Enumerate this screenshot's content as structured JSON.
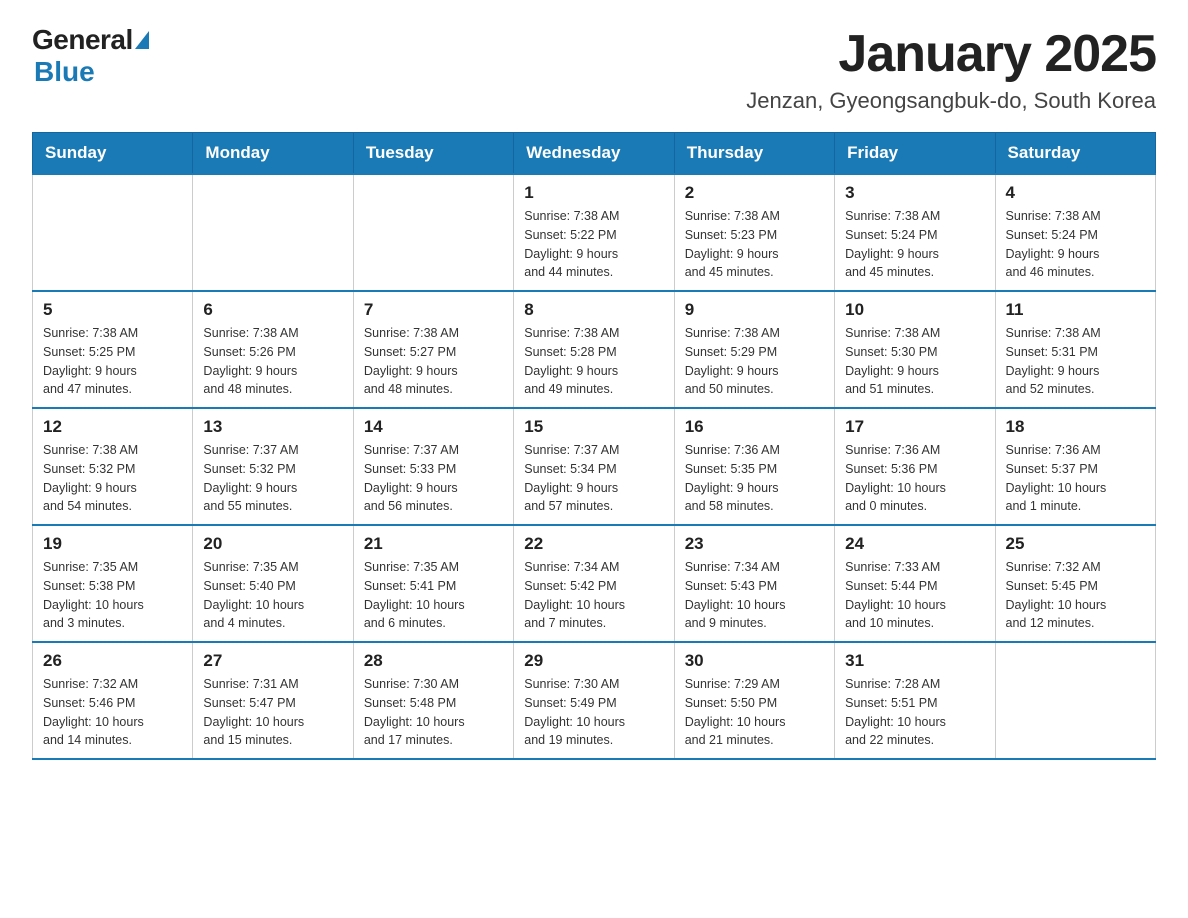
{
  "header": {
    "logo_general": "General",
    "logo_blue": "Blue",
    "title": "January 2025",
    "subtitle": "Jenzan, Gyeongsangbuk-do, South Korea"
  },
  "weekdays": [
    "Sunday",
    "Monday",
    "Tuesday",
    "Wednesday",
    "Thursday",
    "Friday",
    "Saturday"
  ],
  "weeks": [
    [
      {
        "day": "",
        "info": ""
      },
      {
        "day": "",
        "info": ""
      },
      {
        "day": "",
        "info": ""
      },
      {
        "day": "1",
        "info": "Sunrise: 7:38 AM\nSunset: 5:22 PM\nDaylight: 9 hours\nand 44 minutes."
      },
      {
        "day": "2",
        "info": "Sunrise: 7:38 AM\nSunset: 5:23 PM\nDaylight: 9 hours\nand 45 minutes."
      },
      {
        "day": "3",
        "info": "Sunrise: 7:38 AM\nSunset: 5:24 PM\nDaylight: 9 hours\nand 45 minutes."
      },
      {
        "day": "4",
        "info": "Sunrise: 7:38 AM\nSunset: 5:24 PM\nDaylight: 9 hours\nand 46 minutes."
      }
    ],
    [
      {
        "day": "5",
        "info": "Sunrise: 7:38 AM\nSunset: 5:25 PM\nDaylight: 9 hours\nand 47 minutes."
      },
      {
        "day": "6",
        "info": "Sunrise: 7:38 AM\nSunset: 5:26 PM\nDaylight: 9 hours\nand 48 minutes."
      },
      {
        "day": "7",
        "info": "Sunrise: 7:38 AM\nSunset: 5:27 PM\nDaylight: 9 hours\nand 48 minutes."
      },
      {
        "day": "8",
        "info": "Sunrise: 7:38 AM\nSunset: 5:28 PM\nDaylight: 9 hours\nand 49 minutes."
      },
      {
        "day": "9",
        "info": "Sunrise: 7:38 AM\nSunset: 5:29 PM\nDaylight: 9 hours\nand 50 minutes."
      },
      {
        "day": "10",
        "info": "Sunrise: 7:38 AM\nSunset: 5:30 PM\nDaylight: 9 hours\nand 51 minutes."
      },
      {
        "day": "11",
        "info": "Sunrise: 7:38 AM\nSunset: 5:31 PM\nDaylight: 9 hours\nand 52 minutes."
      }
    ],
    [
      {
        "day": "12",
        "info": "Sunrise: 7:38 AM\nSunset: 5:32 PM\nDaylight: 9 hours\nand 54 minutes."
      },
      {
        "day": "13",
        "info": "Sunrise: 7:37 AM\nSunset: 5:32 PM\nDaylight: 9 hours\nand 55 minutes."
      },
      {
        "day": "14",
        "info": "Sunrise: 7:37 AM\nSunset: 5:33 PM\nDaylight: 9 hours\nand 56 minutes."
      },
      {
        "day": "15",
        "info": "Sunrise: 7:37 AM\nSunset: 5:34 PM\nDaylight: 9 hours\nand 57 minutes."
      },
      {
        "day": "16",
        "info": "Sunrise: 7:36 AM\nSunset: 5:35 PM\nDaylight: 9 hours\nand 58 minutes."
      },
      {
        "day": "17",
        "info": "Sunrise: 7:36 AM\nSunset: 5:36 PM\nDaylight: 10 hours\nand 0 minutes."
      },
      {
        "day": "18",
        "info": "Sunrise: 7:36 AM\nSunset: 5:37 PM\nDaylight: 10 hours\nand 1 minute."
      }
    ],
    [
      {
        "day": "19",
        "info": "Sunrise: 7:35 AM\nSunset: 5:38 PM\nDaylight: 10 hours\nand 3 minutes."
      },
      {
        "day": "20",
        "info": "Sunrise: 7:35 AM\nSunset: 5:40 PM\nDaylight: 10 hours\nand 4 minutes."
      },
      {
        "day": "21",
        "info": "Sunrise: 7:35 AM\nSunset: 5:41 PM\nDaylight: 10 hours\nand 6 minutes."
      },
      {
        "day": "22",
        "info": "Sunrise: 7:34 AM\nSunset: 5:42 PM\nDaylight: 10 hours\nand 7 minutes."
      },
      {
        "day": "23",
        "info": "Sunrise: 7:34 AM\nSunset: 5:43 PM\nDaylight: 10 hours\nand 9 minutes."
      },
      {
        "day": "24",
        "info": "Sunrise: 7:33 AM\nSunset: 5:44 PM\nDaylight: 10 hours\nand 10 minutes."
      },
      {
        "day": "25",
        "info": "Sunrise: 7:32 AM\nSunset: 5:45 PM\nDaylight: 10 hours\nand 12 minutes."
      }
    ],
    [
      {
        "day": "26",
        "info": "Sunrise: 7:32 AM\nSunset: 5:46 PM\nDaylight: 10 hours\nand 14 minutes."
      },
      {
        "day": "27",
        "info": "Sunrise: 7:31 AM\nSunset: 5:47 PM\nDaylight: 10 hours\nand 15 minutes."
      },
      {
        "day": "28",
        "info": "Sunrise: 7:30 AM\nSunset: 5:48 PM\nDaylight: 10 hours\nand 17 minutes."
      },
      {
        "day": "29",
        "info": "Sunrise: 7:30 AM\nSunset: 5:49 PM\nDaylight: 10 hours\nand 19 minutes."
      },
      {
        "day": "30",
        "info": "Sunrise: 7:29 AM\nSunset: 5:50 PM\nDaylight: 10 hours\nand 21 minutes."
      },
      {
        "day": "31",
        "info": "Sunrise: 7:28 AM\nSunset: 5:51 PM\nDaylight: 10 hours\nand 22 minutes."
      },
      {
        "day": "",
        "info": ""
      }
    ]
  ]
}
